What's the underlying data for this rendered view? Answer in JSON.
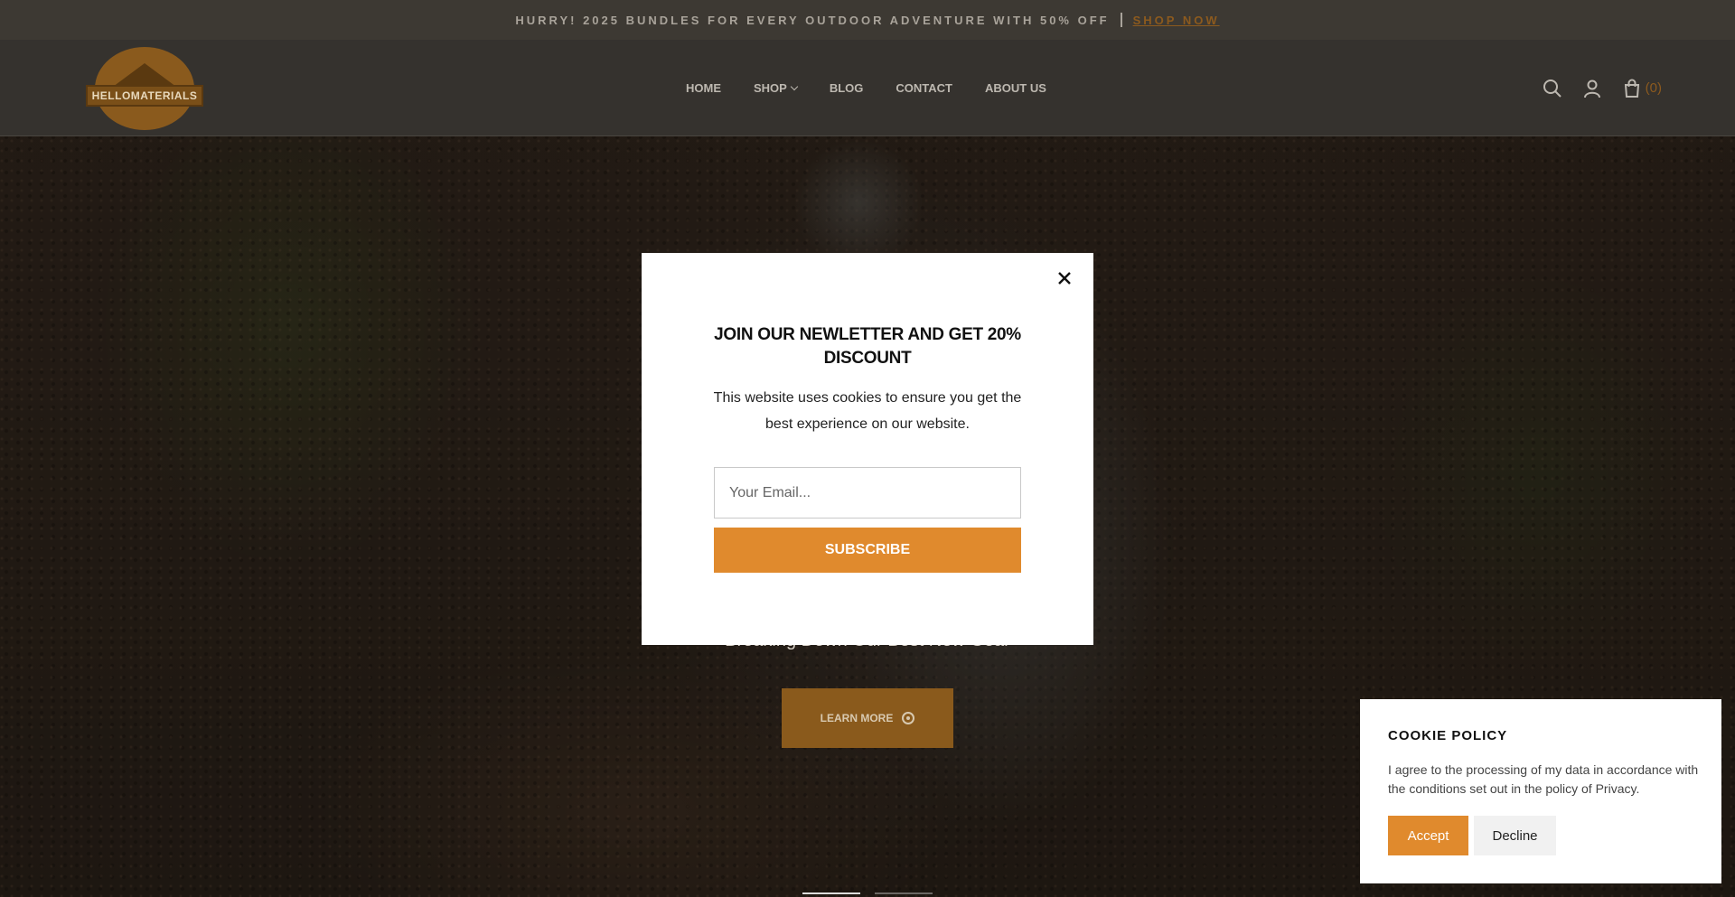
{
  "topbar": {
    "promo_text": "HURRY! 2025 BUNDLES FOR EVERY OUTDOOR ADVENTURE WITH 50% OFF",
    "shop_now": "SHOP NOW"
  },
  "header": {
    "logo_text": "HELLOMATERIALS",
    "nav": [
      "HOME",
      "SHOP",
      "BLOG",
      "CONTACT",
      "ABOUT US"
    ],
    "cart_count": "(0)",
    "icons": [
      "search-icon",
      "user-icon",
      "cart-icon"
    ]
  },
  "hero": {
    "subtitle": "Breaking Down Our Best New Gear",
    "cta_label": "LEARN MORE"
  },
  "newsletter": {
    "title": "JOIN OUR NEWLETTER AND GET 20% DISCOUNT",
    "text": "This website uses cookies to ensure you get the best experience on our website.",
    "email_placeholder": "Your Email...",
    "subscribe_label": "SUBSCRIBE"
  },
  "cookie": {
    "title": "COOKIE POLICY",
    "text": "I agree to the processing of my data in accordance with the conditions set out in the policy of Privacy.",
    "accept_label": "Accept",
    "decline_label": "Decline"
  },
  "colors": {
    "accent": "#e08a2d",
    "topbar_bg": "#3d3933",
    "header_bg": "#35322e"
  }
}
